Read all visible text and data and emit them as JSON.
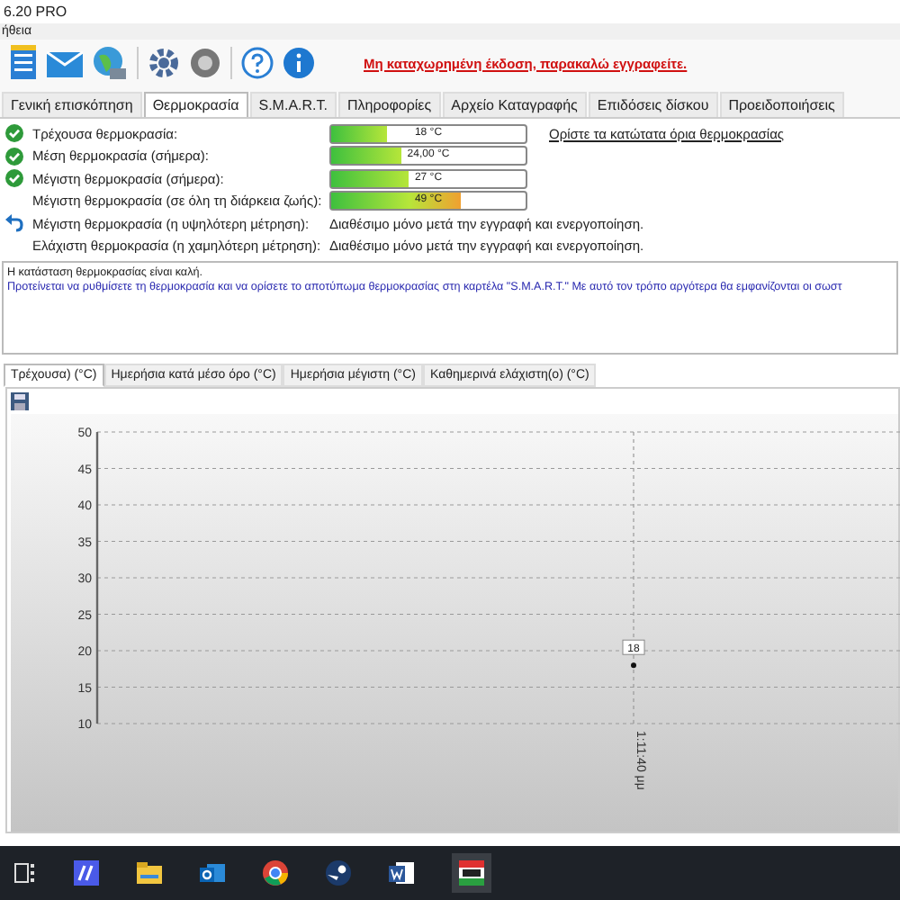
{
  "window": {
    "title": "6.20 PRO"
  },
  "menu": [
    "ήθεια"
  ],
  "register_link": "Μη καταχωρημένη έκδοση, παρακαλώ εγγραφείτε.",
  "tabs": [
    {
      "label": "Γενική επισκόπηση",
      "selected": false
    },
    {
      "label": "Θερμοκρασία",
      "selected": true
    },
    {
      "label": "S.M.A.R.T.",
      "selected": false
    },
    {
      "label": "Πληροφορίες",
      "selected": false
    },
    {
      "label": "Αρχείο Καταγραφής",
      "selected": false
    },
    {
      "label": "Επιδόσεις δίσκου",
      "selected": false
    },
    {
      "label": "Προειδοποιήσεις",
      "selected": false
    }
  ],
  "readings": [
    {
      "kind": "bar",
      "ok": true,
      "reset": false,
      "label": "Τρέχουσα θερμοκρασία:",
      "value": "18 °C",
      "level": 0.29
    },
    {
      "kind": "bar",
      "ok": true,
      "reset": false,
      "label": "Μέση θερμοκρασία (σήμερα):",
      "value": "24,00 °C",
      "level": 0.36
    },
    {
      "kind": "bar",
      "ok": true,
      "reset": false,
      "label": "Μέγιστη θερμοκρασία (σήμερα):",
      "value": "27 °C",
      "level": 0.4
    },
    {
      "kind": "bar",
      "ok": false,
      "reset": false,
      "label": "Μέγιστη θερμοκρασία (σε όλη τη διάρκεια ζωής):",
      "value": "49 °C",
      "level": 0.67
    },
    {
      "kind": "text",
      "ok": false,
      "reset": true,
      "label": "Μέγιστη θερμοκρασία (η υψηλότερη μέτρηση):",
      "value": "Διαθέσιμο μόνο μετά την εγγραφή και ενεργοποίηση."
    },
    {
      "kind": "text",
      "ok": false,
      "reset": false,
      "label": "Ελάχιστη θερμοκρασία (η χαμηλότερη μέτρηση):",
      "value": "Διαθέσιμο μόνο μετά την εγγραφή και ενεργοποίηση."
    }
  ],
  "limits_link": "Ορίστε τα κατώτατα όρια θερμοκρασίας",
  "message": {
    "status": "Η κατάσταση θερμοκρασίας είναι καλή.",
    "advice": "Προτείνεται να ρυθμίσετε τη θερμοκρασία και να ορίσετε το αποτύπωμα θερμοκρασίας στη καρτέλα \"S.M.A.R.T.\" Με αυτό τον τρόπο αργότερα θα εμφανίζονται οι σωστ"
  },
  "chart_tabs": [
    {
      "label": "Τρέχουσα) (°C)",
      "selected": true
    },
    {
      "label": "Ημερήσια κατά μέσο όρο (°C)",
      "selected": false
    },
    {
      "label": "Ημερήσια μέγιστη (°C)",
      "selected": false
    },
    {
      "label": "Καθημερινά ελάχιστη(ο) (°C)",
      "selected": false
    }
  ],
  "chart_data": {
    "type": "line",
    "categories": [
      "1:11:40 μμ"
    ],
    "series": [
      {
        "values": [
          18
        ],
        "marker": true
      }
    ],
    "ylim": [
      10,
      50
    ],
    "yticks": [
      10,
      15,
      20,
      25,
      30,
      35,
      40,
      45,
      50
    ],
    "data_labels": true,
    "grid": true
  }
}
